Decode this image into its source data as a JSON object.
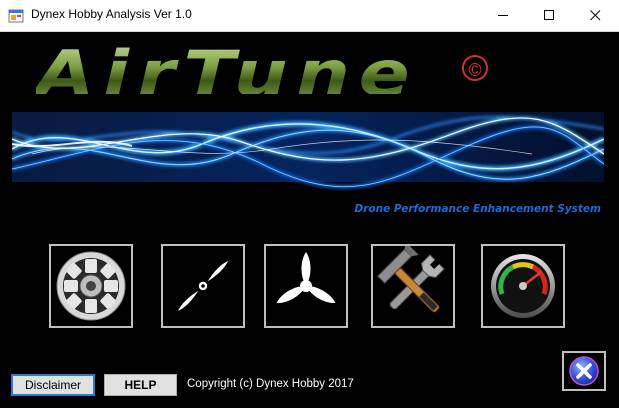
{
  "window": {
    "title": "Dynex Hobby Analysis Ver 1.0",
    "icons": {
      "app": "app-window-icon",
      "minimize": "minimize-icon",
      "maximize": "maximize-icon",
      "close": "close-icon"
    }
  },
  "logo": {
    "text": "AirTune",
    "mark": "©"
  },
  "banner": {
    "tagline": "Drone Performance Enhancement System",
    "accent": "#1e6cd6"
  },
  "tools": [
    {
      "icon": "motor-icon"
    },
    {
      "icon": "two-blade-propeller-icon"
    },
    {
      "icon": "three-blade-propeller-icon"
    },
    {
      "icon": "wrench-hammer-tools-icon"
    },
    {
      "icon": "speedometer-gauge-icon"
    }
  ],
  "exit": {
    "icon": "exit-x-icon"
  },
  "footer": {
    "disclaimer_label": "Disclaimer",
    "help_label": "HELP",
    "copyright": "Copyright (c) Dynex Hobby 2017"
  }
}
